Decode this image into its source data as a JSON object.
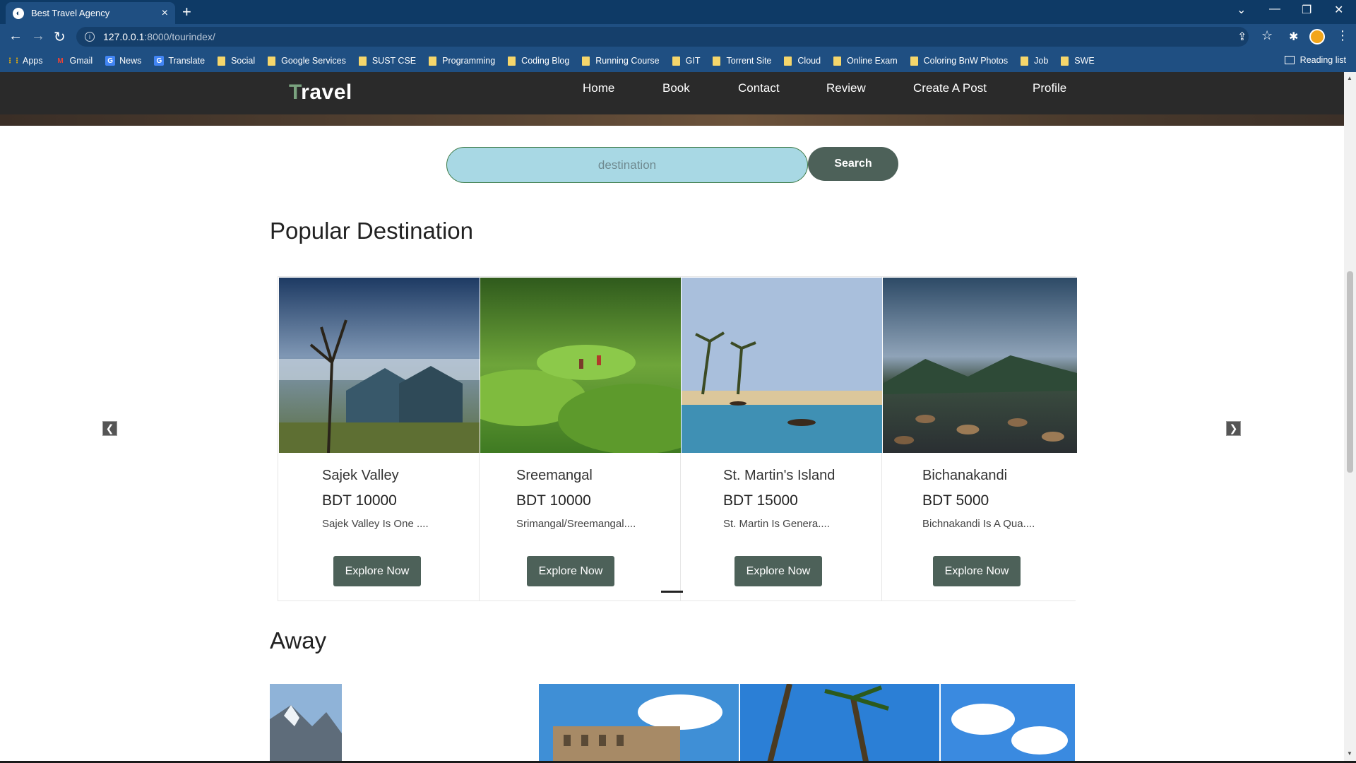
{
  "browser": {
    "tab_title": "Best Travel Agency",
    "tab_close": "×",
    "new_tab": "+",
    "url_host": "127.0.0.1",
    "url_path": ":8000/tourindex/",
    "win_menu": "⌄",
    "win_min": "—",
    "win_restore": "❐",
    "win_close": "✕",
    "back": "←",
    "forward": "→",
    "reload": "↻",
    "share": "⇪",
    "star": "☆",
    "ext": "✱",
    "more": "⋮",
    "bookmarks": [
      "Apps",
      "Gmail",
      "News",
      "Translate",
      "Social",
      "Google Services",
      "SUST CSE",
      "Programming",
      "Coding Blog",
      "Running Course",
      "GIT",
      "Torrent Site",
      "Cloud",
      "Online Exam",
      "Coloring BnW Photos",
      "Job",
      "SWE"
    ],
    "reading_list": "Reading list"
  },
  "nav": {
    "logo_first": "T",
    "logo_rest": "ravel",
    "links": [
      "Home",
      "Book",
      "Contact",
      "Review",
      "Create A Post",
      "Profile"
    ]
  },
  "search": {
    "placeholder": "destination",
    "button": "Search"
  },
  "popular": {
    "title": "Popular Destination",
    "cards": [
      {
        "name": "Sajek Valley",
        "price": "BDT 10000",
        "desc": "Sajek Valley Is One ....",
        "button": "Explore Now"
      },
      {
        "name": "Sreemangal",
        "price": "BDT 10000",
        "desc": "Srimangal/Sreemangal....",
        "button": "Explore Now"
      },
      {
        "name": "St. Martin's Island",
        "price": "BDT 15000",
        "desc": "St. Martin Is Genera....",
        "button": "Explore Now"
      },
      {
        "name": "Bichanakandi",
        "price": "BDT 5000",
        "desc": "Bichnakandi Is A Qua....",
        "button": "Explore Now"
      }
    ],
    "prev": "❮",
    "next": "❯"
  },
  "away": {
    "title": "Away"
  }
}
